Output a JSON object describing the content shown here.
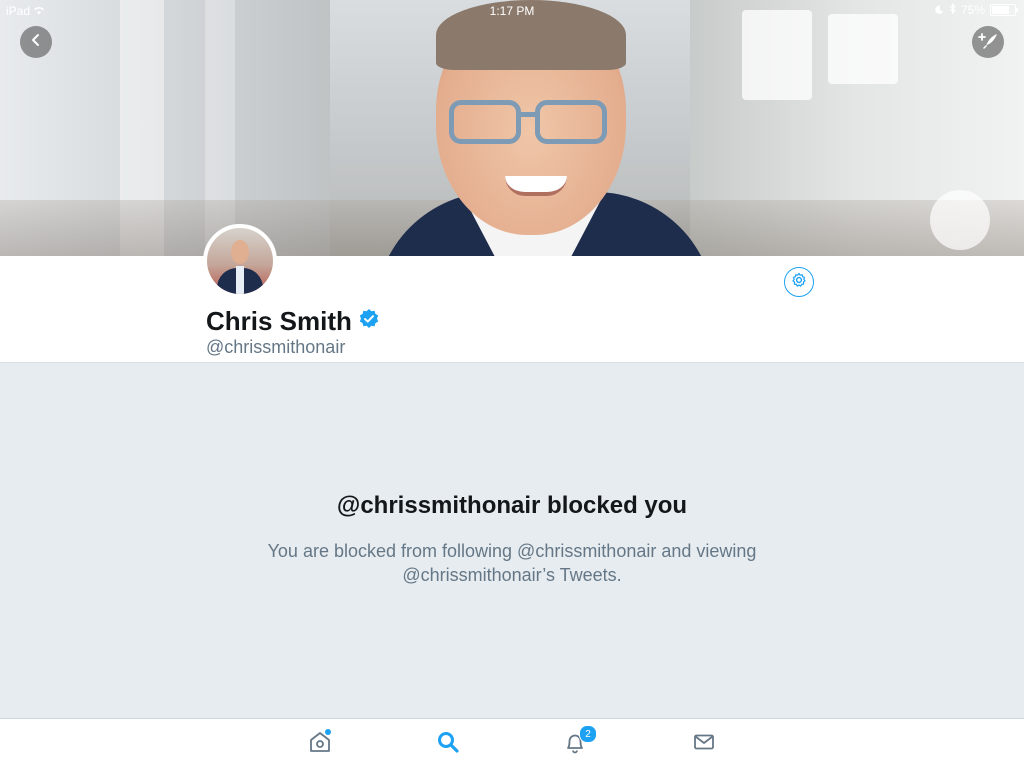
{
  "status_bar": {
    "device": "iPad",
    "time": "1:17 PM",
    "battery": "75%",
    "battery_level": 0.75
  },
  "header": {
    "back_icon": "chevron-left-icon",
    "compose_icon": "compose-tweet-icon"
  },
  "profile": {
    "name": "Chris Smith",
    "verified": true,
    "handle": "@chrissmithonair",
    "settings_icon": "gear-icon"
  },
  "blocked": {
    "title": "@chrissmithonair blocked you",
    "description": "You are blocked from following @chrissmithonair and viewing @chrissmithonair’s Tweets."
  },
  "tabbar": {
    "tabs": [
      {
        "name": "home",
        "icon": "home-icon",
        "active": false,
        "has_dot": true
      },
      {
        "name": "search",
        "icon": "search-icon",
        "active": true
      },
      {
        "name": "notifications",
        "icon": "bell-icon",
        "active": false,
        "badge": "2"
      },
      {
        "name": "messages",
        "icon": "mail-icon",
        "active": false
      }
    ]
  },
  "colors": {
    "accent": "#1da1f2",
    "text_primary": "#14171a",
    "text_secondary": "#657786",
    "background": "#e6ecf0"
  }
}
